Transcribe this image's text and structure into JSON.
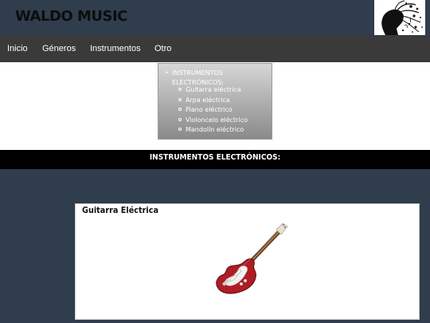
{
  "site": {
    "brand": "WALDO MUSIC"
  },
  "nav": {
    "items": [
      "Inicio",
      "Géneros",
      "Instrumentos",
      "Otro"
    ]
  },
  "dropdown": {
    "heading_line1": "INSTRUMENTOS",
    "heading_line2": "ELECTRÓNICOS:",
    "items": [
      "Guitarra eléctrica",
      "Arpa eléctrica",
      "Piano eléctrico",
      "Violoncelo eléctrico",
      "Mandolín eléctrico"
    ]
  },
  "section": {
    "title": "INSTRUMENTOS ELECTRÓNICOS:"
  },
  "card": {
    "title": "Guitarra Eléctrica",
    "image_icon": "electric-guitar",
    "guitar_color": "#b01c24"
  },
  "colors": {
    "page_bg": "#2f3d4c",
    "navbar_bg": "#3a3a3a",
    "section_bar_bg": "#000000"
  }
}
